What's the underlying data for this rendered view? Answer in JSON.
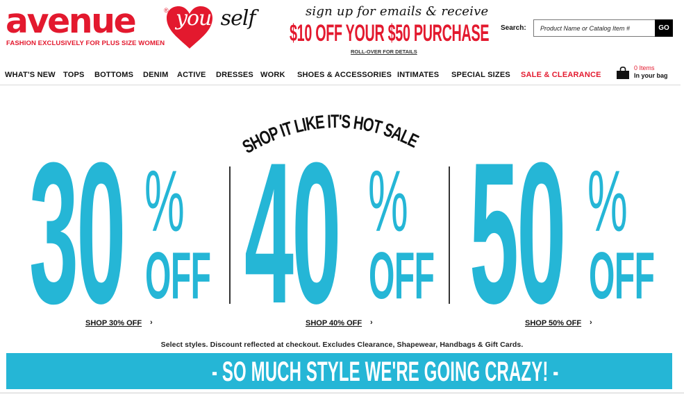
{
  "header": {
    "logo_word": "avenue",
    "logo_reg": "®",
    "logo_your": "your",
    "logo_self": "self",
    "logo_tagline": "FASHION EXCLUSIVELY FOR PLUS SIZE WOMEN",
    "promo_line1": "sign up for emails & receive",
    "promo_line2": "$10 OFF YOUR $50 PURCHASE",
    "promo_line3": "ROLL-OVER FOR DETAILS"
  },
  "search": {
    "label": "Search:",
    "placeholder": "Product Name or Catalog Item #",
    "button": "GO"
  },
  "nav": {
    "items": [
      "WHAT'S NEW",
      "TOPS",
      "BOTTOMS",
      "DENIM",
      "ACTIVE",
      "DRESSES",
      "WORK",
      "SHOES & ACCESSORIES",
      "INTIMATES",
      "SPECIAL SIZES",
      "SALE & CLEARANCE"
    ]
  },
  "bag": {
    "icon": "shopping-bag-icon",
    "count": "0 Items",
    "label": "In your bag"
  },
  "hero": {
    "title": "SHOP IT LIKE IT'S HOT SALE",
    "offers": [
      {
        "number": "30",
        "percent": "%",
        "off": "OFF",
        "link": "SHOP 30% OFF",
        "arrow": "›"
      },
      {
        "number": "40",
        "percent": "%",
        "off": "OFF",
        "link": "SHOP 40% OFF",
        "arrow": "›"
      },
      {
        "number": "50",
        "percent": "%",
        "off": "OFF",
        "link": "SHOP 50% OFF",
        "arrow": "›"
      }
    ],
    "disclaimer": "Select styles. Discount reflected at checkout. Excludes Clearance, Shapewear, Handbags & Gift Cards."
  },
  "banner": {
    "text": "- SO MUCH STYLE WE'RE GOING CRAZY! -"
  },
  "colors": {
    "brand_red": "#e3192e",
    "sale_blue": "#25b6d6",
    "text_dark": "#111111"
  }
}
